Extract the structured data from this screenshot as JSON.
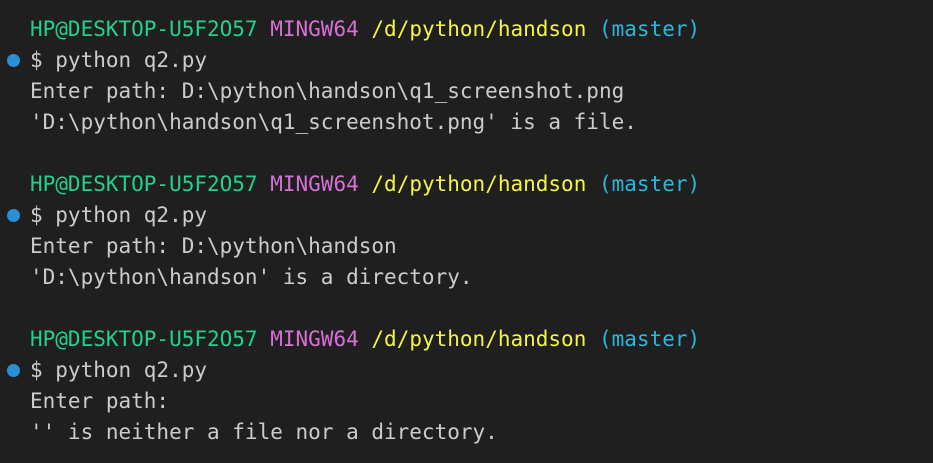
{
  "colors": {
    "background": "#1f1f1f",
    "text": "#cccccc",
    "user_host": "#23d18b",
    "system": "#d670d6",
    "path": "#f5f543",
    "branch": "#29b8db",
    "decoration_dot": "#2b8fd6"
  },
  "blocks": [
    {
      "prompt": {
        "user_host": "HP@DESKTOP-U5F2O57",
        "system": "MINGW64",
        "path": "/d/python/handson",
        "branch": "(master)"
      },
      "command": "$ python q2.py",
      "outputs": [
        "Enter path: D:\\python\\handson\\q1_screenshot.png",
        "'D:\\python\\handson\\q1_screenshot.png' is a file."
      ]
    },
    {
      "prompt": {
        "user_host": "HP@DESKTOP-U5F2O57",
        "system": "MINGW64",
        "path": "/d/python/handson",
        "branch": "(master)"
      },
      "command": "$ python q2.py",
      "outputs": [
        "Enter path: D:\\python\\handson",
        "'D:\\python\\handson' is a directory."
      ]
    },
    {
      "prompt": {
        "user_host": "HP@DESKTOP-U5F2O57",
        "system": "MINGW64",
        "path": "/d/python/handson",
        "branch": "(master)"
      },
      "command": "$ python q2.py",
      "outputs": [
        "Enter path:",
        "'' is neither a file nor a directory."
      ]
    }
  ]
}
